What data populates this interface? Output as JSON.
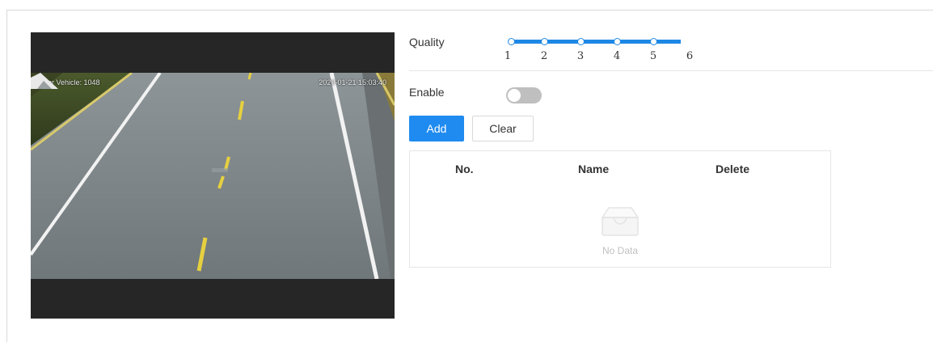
{
  "video": {
    "osd_left": "Motor Vehicle: 1048",
    "osd_right": "2020-01-21 15:03:40"
  },
  "quality": {
    "label": "Quality",
    "ticks": [
      "1",
      "2",
      "3",
      "4",
      "5",
      "6"
    ],
    "value_range": [
      1,
      5
    ]
  },
  "enable": {
    "label": "Enable",
    "state": "off"
  },
  "toolbar": {
    "add_label": "Add",
    "clear_label": "Clear"
  },
  "table": {
    "columns": [
      "No.",
      "Name",
      "Delete"
    ],
    "rows": [],
    "empty_text": "No Data"
  },
  "colors": {
    "accent": "#1f8bf0",
    "toggle_off": "#bfbfbf"
  }
}
